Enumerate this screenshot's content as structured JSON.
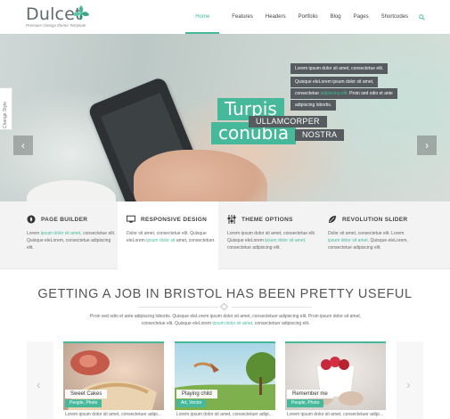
{
  "brand": {
    "name": "Dulcet",
    "tagline": "Premium Omega theme Template",
    "accent": "#47b99b",
    "logo_icon": "leaf-icon"
  },
  "nav": {
    "items": [
      {
        "label": "Home",
        "active": true
      },
      {
        "label": "Features"
      },
      {
        "label": "Headers"
      },
      {
        "label": "Portfolio"
      },
      {
        "label": "Blog"
      },
      {
        "label": "Pages"
      },
      {
        "label": "Shortcodes"
      }
    ],
    "search_icon": "search-icon"
  },
  "style_switcher": {
    "label": "Change Style"
  },
  "slider": {
    "prev_icon": "chevron-left-icon",
    "next_icon": "chevron-right-icon",
    "title_line1": "Turpis",
    "title_line2": "conubia",
    "lines": [
      {
        "text": "Lorem ipsum dolor sit amet, consectetue elit."
      },
      {
        "text": "Quisque eleLorem ipsum dolor sit amet,"
      },
      {
        "pre": "consectetue ",
        "hl": "adipiscing elit.",
        "post": " Proin sed odio et ante"
      },
      {
        "text": "adipiscing lobortis."
      }
    ],
    "tags": [
      "ULLAMCORPER",
      "NOSTRA"
    ]
  },
  "features": [
    {
      "title": "PAGE BUILDER",
      "icon": "compass-icon",
      "pre": "Lorem ",
      "hl": "ipsum dolor sit amet,",
      "post": " consectetue elit. Quisque eleLorem, consectetue adipiscing elit."
    },
    {
      "title": "RESPONSIVE DESIGN",
      "icon": "monitor-icon",
      "pre": "Dolor sit amet, consectetue elit. Quisque eleLorem ",
      "hl": "ipsum dolor sit",
      "post": " amet, consectetuer."
    },
    {
      "title": "THEME OPTIONS",
      "icon": "sliders-icon",
      "pre": "Lorem ipsum dolor sit amet, consectetue elit. Quisque eleLorem ",
      "hl": "ipsum dolor sit amet,",
      "post": " consectetue adipiscing elit."
    },
    {
      "title": "REVOLUTION SLIDER",
      "icon": "leaf-icon",
      "pre": "Dolor sit amet, consectetue elit. Lorem ",
      "hl": "ipsum dolor sit amet,",
      "post": " Quisque eleLorem, consectetue adipiscing elit."
    }
  ],
  "section": {
    "title": "GETTING A JOB IN BRISTOL HAS BEEN PRETTY USEFUL",
    "divider_icon": "diamond-icon",
    "text_pre": "Proin sed odio et ante adipiscing lobortis. Quisque eleLorem ipsum dolor sit amet, consectetuer adipiscing elit. Proin ipsum dolor sit amet, consectetue elit. Quisque eleLorem ",
    "text_hl": "ipsum dolor sit amet,",
    "text_post": " consectetuer adipiscing elit."
  },
  "portfolio": {
    "prev_icon": "chevron-left-icon",
    "next_icon": "chevron-right-icon",
    "items": [
      {
        "title": "Sweet Cakes",
        "category": "People, Photo",
        "desc": "Lorem ipsum dolor sit amet, consectetuer adipi..."
      },
      {
        "title": "Playing child",
        "category": "Art, Vector",
        "desc": "Lorem ipsum dolor sit amet, consectetuer adipi..."
      },
      {
        "title": "Remember me",
        "category": "People, Photo",
        "desc": "Lorem ipsum dolor sit amet, consectetuer adipi..."
      }
    ]
  }
}
